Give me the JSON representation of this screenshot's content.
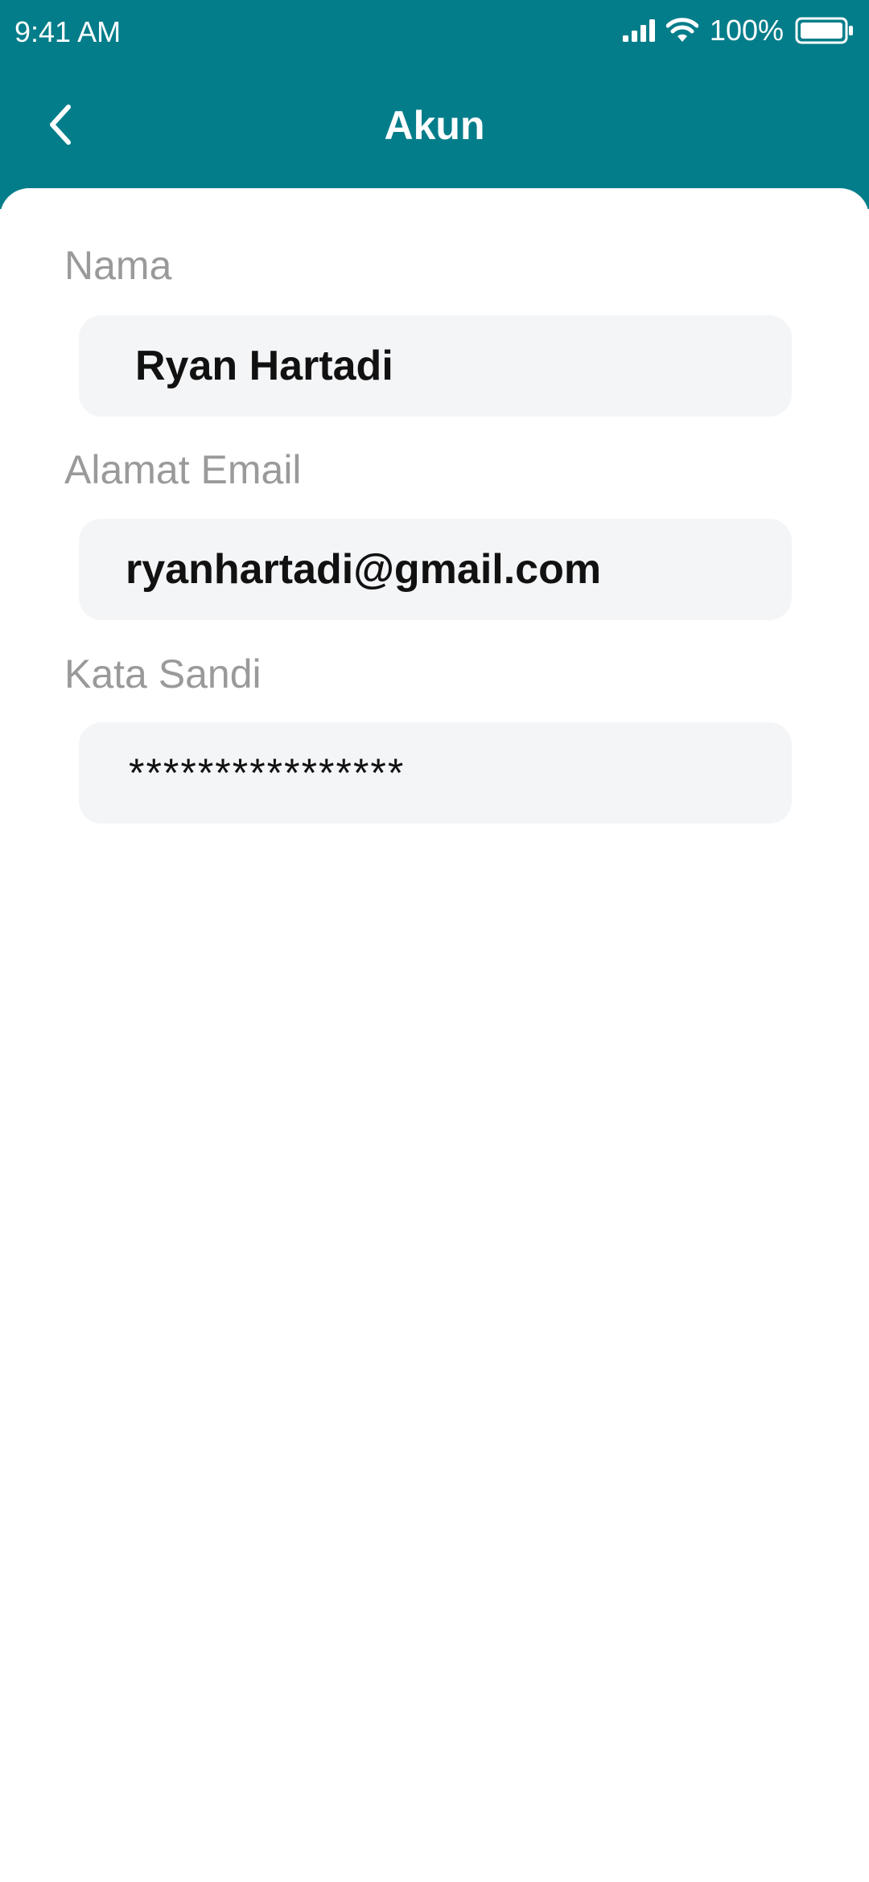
{
  "status_bar": {
    "time": "9:41 AM",
    "battery": "100%",
    "icons": [
      "signal-icon",
      "wifi-icon",
      "battery-icon"
    ]
  },
  "header": {
    "title": "Akun",
    "back_icon": "chevron-left-icon",
    "color": "#047d8a"
  },
  "form": {
    "name": {
      "label": "Nama",
      "value": "Ryan Hartadi"
    },
    "email": {
      "label": "Alamat Email",
      "value": "ryanhartadi@gmail.com"
    },
    "password": {
      "label": "Kata Sandi",
      "value": "****************"
    }
  }
}
